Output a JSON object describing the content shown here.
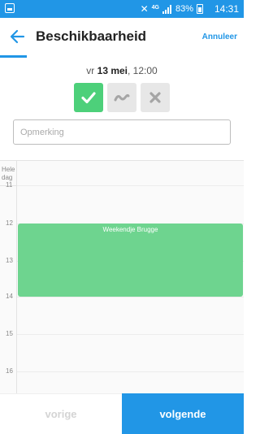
{
  "status_bar": {
    "network": "4G",
    "battery": "83%",
    "time": "14:31"
  },
  "header": {
    "title": "Beschikbaarheid",
    "cancel_label": "Annuleer"
  },
  "date": {
    "weekday": "vr",
    "day_month": "13 mei",
    "time": "12:00"
  },
  "availability": {
    "selected": "yes",
    "options": [
      {
        "id": "yes",
        "icon": "check-icon",
        "color": "#4dd07a"
      },
      {
        "id": "maybe",
        "icon": "wave-icon",
        "color": "#e7e7e7"
      },
      {
        "id": "no",
        "icon": "x-icon",
        "color": "#e7e7e7"
      }
    ]
  },
  "remark": {
    "placeholder": "Opmerking",
    "value": ""
  },
  "calendar": {
    "allday_line1": "Hele",
    "allday_line2": "dag",
    "hours": [
      "11",
      "12",
      "13",
      "14",
      "15",
      "16"
    ],
    "event": {
      "title": "Weekendje Brugge",
      "color": "#6ed48f"
    }
  },
  "footer": {
    "prev_label": "vorige",
    "next_label": "volgende"
  },
  "colors": {
    "accent": "#2196e6",
    "available": "#4dd07a"
  }
}
